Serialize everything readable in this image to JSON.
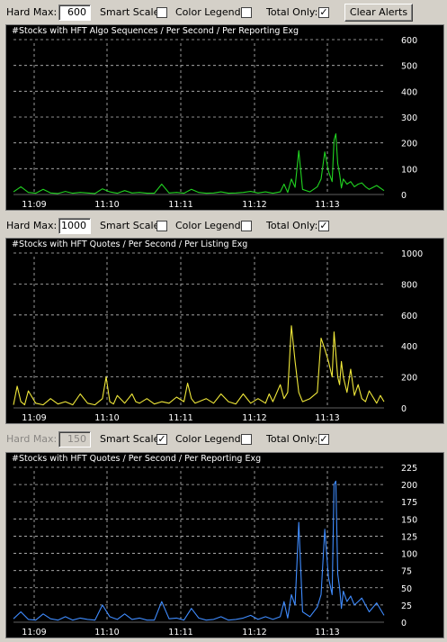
{
  "colors": {
    "bg": "#d4d0c8",
    "chart_bg": "#000000",
    "grid": "#bdbdbd",
    "panel1_line": "#21d321",
    "panel2_line": "#f0e83a",
    "panel3_line": "#3f8cff"
  },
  "panels": [
    {
      "controls": {
        "hard_max_label": "Hard Max:",
        "hard_max_value": "600",
        "hard_max_enabled": true,
        "smart_scale_label": "Smart Scale:",
        "smart_scale_checked": "",
        "color_legend_label": "Color Legend:",
        "color_legend_checked": "",
        "total_only_label": "Total Only:",
        "total_only_checked": "✓",
        "clear_alerts_label": "Clear Alerts"
      },
      "title": "#Stocks with HFT Algo Sequences / Per Second / Per Reporting Exg"
    },
    {
      "controls": {
        "hard_max_label": "Hard Max:",
        "hard_max_value": "1000",
        "hard_max_enabled": true,
        "smart_scale_label": "Smart Scale:",
        "smart_scale_checked": "",
        "color_legend_label": "Color Legend:",
        "color_legend_checked": "",
        "total_only_label": "Total Only:",
        "total_only_checked": "✓"
      },
      "title": "#Stocks with HFT Quotes / Per Second / Per Listing Exg"
    },
    {
      "controls": {
        "hard_max_label": "Hard Max:",
        "hard_max_value": "150",
        "hard_max_enabled": false,
        "smart_scale_label": "Smart Scale:",
        "smart_scale_checked": "✓",
        "color_legend_label": "Color Legend:",
        "color_legend_checked": "",
        "total_only_label": "Total Only:",
        "total_only_checked": "✓"
      },
      "title": "#Stocks with HFT Quotes / Per Second / Per Reporting Exg"
    }
  ],
  "chart_data": [
    {
      "type": "line",
      "title": "#Stocks with HFT Algo Sequences / Per Second / Per Reporting Exg",
      "x_ticks": [
        "11:09",
        "11:10",
        "11:11",
        "11:12",
        "11:13"
      ],
      "y_ticks": [
        "0",
        "100",
        "200",
        "300",
        "400",
        "500",
        "600"
      ],
      "ylim": [
        0,
        600
      ],
      "xlim": [
        0,
        100
      ],
      "grid": true,
      "series": [
        {
          "color": "#21d321",
          "x": [
            0,
            2,
            4,
            6,
            8,
            10,
            12,
            14,
            16,
            18,
            20,
            22,
            24,
            26,
            28,
            30,
            32,
            34,
            36,
            38,
            40,
            42,
            44,
            46,
            48,
            50,
            52,
            54,
            56,
            58,
            60,
            62,
            64,
            66,
            68,
            70,
            72,
            73,
            74,
            75,
            76,
            77,
            78,
            80,
            82,
            83,
            84,
            85,
            86,
            86.5,
            87,
            87.5,
            88,
            88.5,
            89,
            90,
            91,
            92,
            93,
            94,
            95,
            96,
            98,
            100
          ],
          "values": [
            10,
            30,
            8,
            5,
            20,
            6,
            4,
            12,
            5,
            8,
            6,
            4,
            22,
            10,
            5,
            15,
            6,
            8,
            5,
            5,
            40,
            6,
            8,
            5,
            20,
            8,
            5,
            6,
            10,
            5,
            6,
            8,
            12,
            6,
            10,
            5,
            10,
            40,
            8,
            60,
            28,
            170,
            20,
            10,
            30,
            60,
            165,
            90,
            50,
            210,
            235,
            120,
            80,
            25,
            60,
            40,
            50,
            30,
            40,
            45,
            30,
            20,
            35,
            15
          ]
        }
      ]
    },
    {
      "type": "line",
      "title": "#Stocks with HFT Quotes / Per Second / Per Listing Exg",
      "x_ticks": [
        "11:09",
        "11:10",
        "11:11",
        "11:12",
        "11:13"
      ],
      "y_ticks": [
        "0",
        "200",
        "400",
        "600",
        "800",
        "1000"
      ],
      "ylim": [
        0,
        1000
      ],
      "xlim": [
        0,
        100
      ],
      "grid": true,
      "series": [
        {
          "color": "#f0e83a",
          "x": [
            0,
            1,
            2,
            3,
            4,
            6,
            8,
            10,
            12,
            14,
            16,
            18,
            20,
            22,
            24,
            25,
            26,
            27,
            28,
            30,
            32,
            33,
            34,
            36,
            38,
            40,
            42,
            44,
            46,
            47,
            48,
            49,
            50,
            52,
            54,
            56,
            58,
            60,
            62,
            64,
            66,
            68,
            69,
            70,
            72,
            73,
            74,
            75,
            76,
            77,
            78,
            80,
            82,
            83,
            84,
            85,
            86,
            86.5,
            87,
            87.5,
            88,
            88.5,
            89,
            90,
            91,
            92,
            93,
            94,
            95,
            96,
            98,
            99,
            100
          ],
          "values": [
            20,
            140,
            40,
            20,
            110,
            30,
            20,
            60,
            25,
            40,
            20,
            90,
            30,
            20,
            60,
            200,
            40,
            25,
            80,
            30,
            90,
            40,
            30,
            60,
            25,
            40,
            30,
            70,
            40,
            160,
            60,
            30,
            40,
            60,
            30,
            90,
            40,
            25,
            90,
            30,
            60,
            30,
            90,
            40,
            150,
            60,
            100,
            530,
            300,
            100,
            40,
            60,
            100,
            450,
            380,
            300,
            200,
            490,
            350,
            200,
            150,
            300,
            200,
            100,
            250,
            80,
            150,
            60,
            40,
            110,
            30,
            80,
            40
          ]
        }
      ]
    },
    {
      "type": "line",
      "title": "#Stocks with HFT Quotes / Per Second / Per Reporting Exg",
      "x_ticks": [
        "11:09",
        "11:10",
        "11:11",
        "11:12",
        "11:13"
      ],
      "y_ticks": [
        "0",
        "25",
        "50",
        "75",
        "100",
        "125",
        "150",
        "175",
        "200",
        "225"
      ],
      "ylim": [
        0,
        225
      ],
      "xlim": [
        0,
        100
      ],
      "grid": true,
      "series": [
        {
          "color": "#3f8cff",
          "x": [
            0,
            2,
            4,
            6,
            8,
            10,
            12,
            14,
            16,
            18,
            20,
            22,
            24,
            26,
            28,
            30,
            32,
            34,
            36,
            38,
            40,
            42,
            44,
            46,
            48,
            50,
            52,
            54,
            56,
            58,
            60,
            62,
            64,
            66,
            68,
            70,
            72,
            73,
            74,
            75,
            76,
            77,
            78,
            80,
            82,
            83,
            84,
            85,
            86,
            86.5,
            87,
            87.5,
            88,
            88.5,
            89,
            90,
            91,
            92,
            93,
            94,
            95,
            96,
            98,
            100
          ],
          "values": [
            5,
            15,
            4,
            3,
            12,
            5,
            3,
            8,
            3,
            6,
            4,
            3,
            25,
            8,
            4,
            12,
            4,
            6,
            3,
            3,
            30,
            5,
            6,
            3,
            20,
            6,
            3,
            4,
            8,
            3,
            4,
            6,
            10,
            4,
            8,
            4,
            8,
            30,
            6,
            40,
            25,
            145,
            15,
            8,
            22,
            40,
            135,
            65,
            40,
            200,
            205,
            70,
            50,
            20,
            45,
            30,
            38,
            25,
            30,
            35,
            25,
            15,
            28,
            10
          ]
        }
      ]
    }
  ]
}
